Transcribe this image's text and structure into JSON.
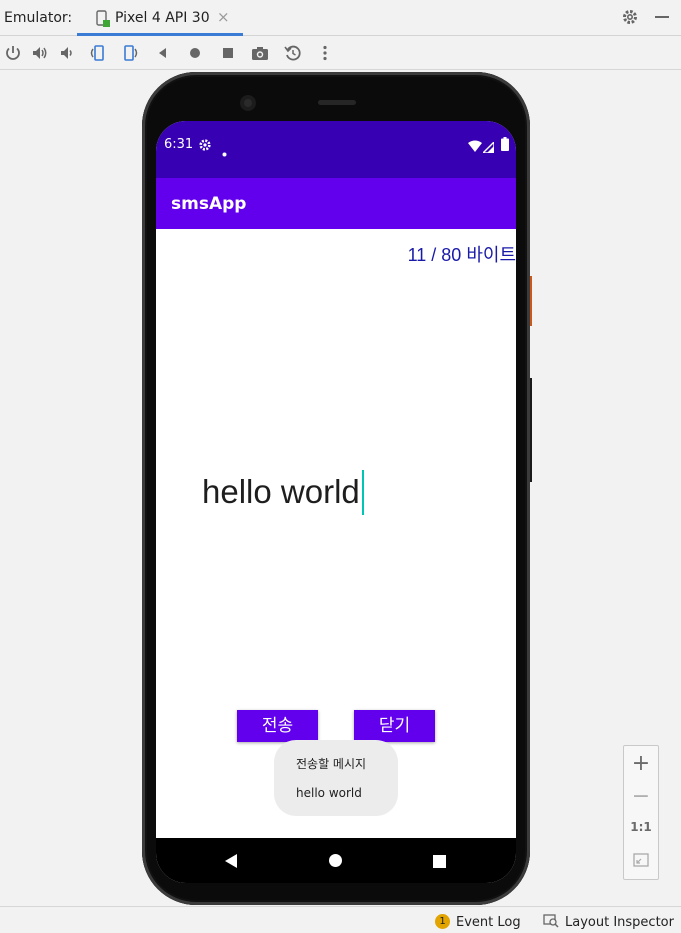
{
  "window": {
    "label": "Emulator:",
    "tab_title": "Pixel 4 API 30",
    "tab_close": "×"
  },
  "toolbar": {
    "icons": [
      "power-icon",
      "volume-up-icon",
      "volume-down-icon",
      "rotate-left-icon",
      "rotate-right-icon",
      "back-icon",
      "home-icon",
      "overview-icon",
      "screenshot-icon",
      "snapshot-icon",
      "more-icon"
    ]
  },
  "device": {
    "status_time": "6:31",
    "app_title": "smsApp",
    "byte_counter": "11 / 80 바이트",
    "message_text": "hello world",
    "send_button": "전송",
    "close_button": "닫기",
    "toast": {
      "line1": "전송할 메시지",
      "line2": "hello world"
    }
  },
  "zoom": {
    "zoom_in": "+",
    "zoom_out": "−",
    "actual_size": "1:1"
  },
  "statusbar": {
    "event_log_count": "1",
    "event_log": "Event Log",
    "layout_inspector": "Layout Inspector"
  },
  "colors": {
    "status_bar": "#3700b3",
    "app_bar": "#6200ee",
    "button": "#6200ee",
    "byte_counter": "#1a1aa8",
    "cursor": "#00c4b4"
  }
}
